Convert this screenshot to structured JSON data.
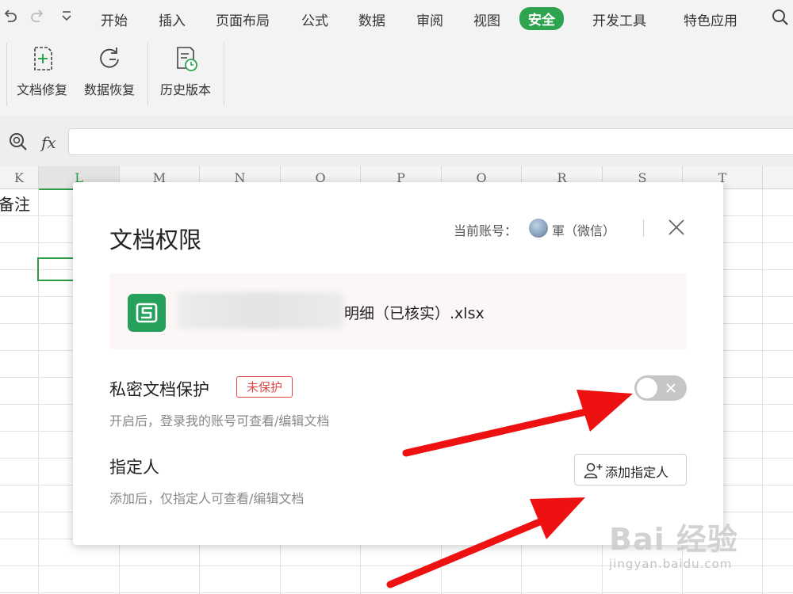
{
  "quick_access": {
    "undo_icon": "undo-icon",
    "redo_icon": "redo-icon",
    "dropdown_icon": "chevron-down-icon"
  },
  "menu": {
    "items": [
      "开始",
      "插入",
      "页面布局",
      "公式",
      "数据",
      "审阅",
      "视图",
      "安全",
      "开发工具",
      "特色应用"
    ],
    "active_index": 7,
    "active_color": "#2fa44f",
    "search_icon": "search-icon"
  },
  "ribbon": {
    "buttons": [
      {
        "label": "文档修复",
        "icon": "document-repair-icon"
      },
      {
        "label": "数据恢复",
        "icon": "data-recovery-icon"
      },
      {
        "label": "历史版本",
        "icon": "history-version-icon"
      }
    ]
  },
  "formula_bar": {
    "zoom_icon": "zoom-icon",
    "fx_label": "fx",
    "value": ""
  },
  "columns": [
    "K",
    "L",
    "M",
    "N",
    "O",
    "P",
    "Q",
    "R",
    "S",
    "T"
  ],
  "cells": {
    "k1": "备注"
  },
  "dialog": {
    "title": "文档权限",
    "account_label": "当前账号：",
    "account_name": "軍（微信）",
    "close_icon": "close-icon",
    "file": {
      "icon": "spreadsheet-file-icon",
      "icon_letter": "S",
      "name_suffix": "明细（已核实）.xlsx",
      "icon_color": "#25a15c"
    },
    "private_protection": {
      "title": "私密文档保护",
      "badge": "未保护",
      "description": "开启后，登录我的账号可查看/编辑文档",
      "toggle_on": false
    },
    "designee": {
      "title": "指定人",
      "description": "添加后，仅指定人可查看/编辑文档",
      "button_label": "添加指定人",
      "button_icon": "add-user-icon"
    }
  },
  "watermark": {
    "logo": "Bai 经验",
    "url": "jingyan.baidu.com"
  },
  "annotation_color": "#ee1111"
}
